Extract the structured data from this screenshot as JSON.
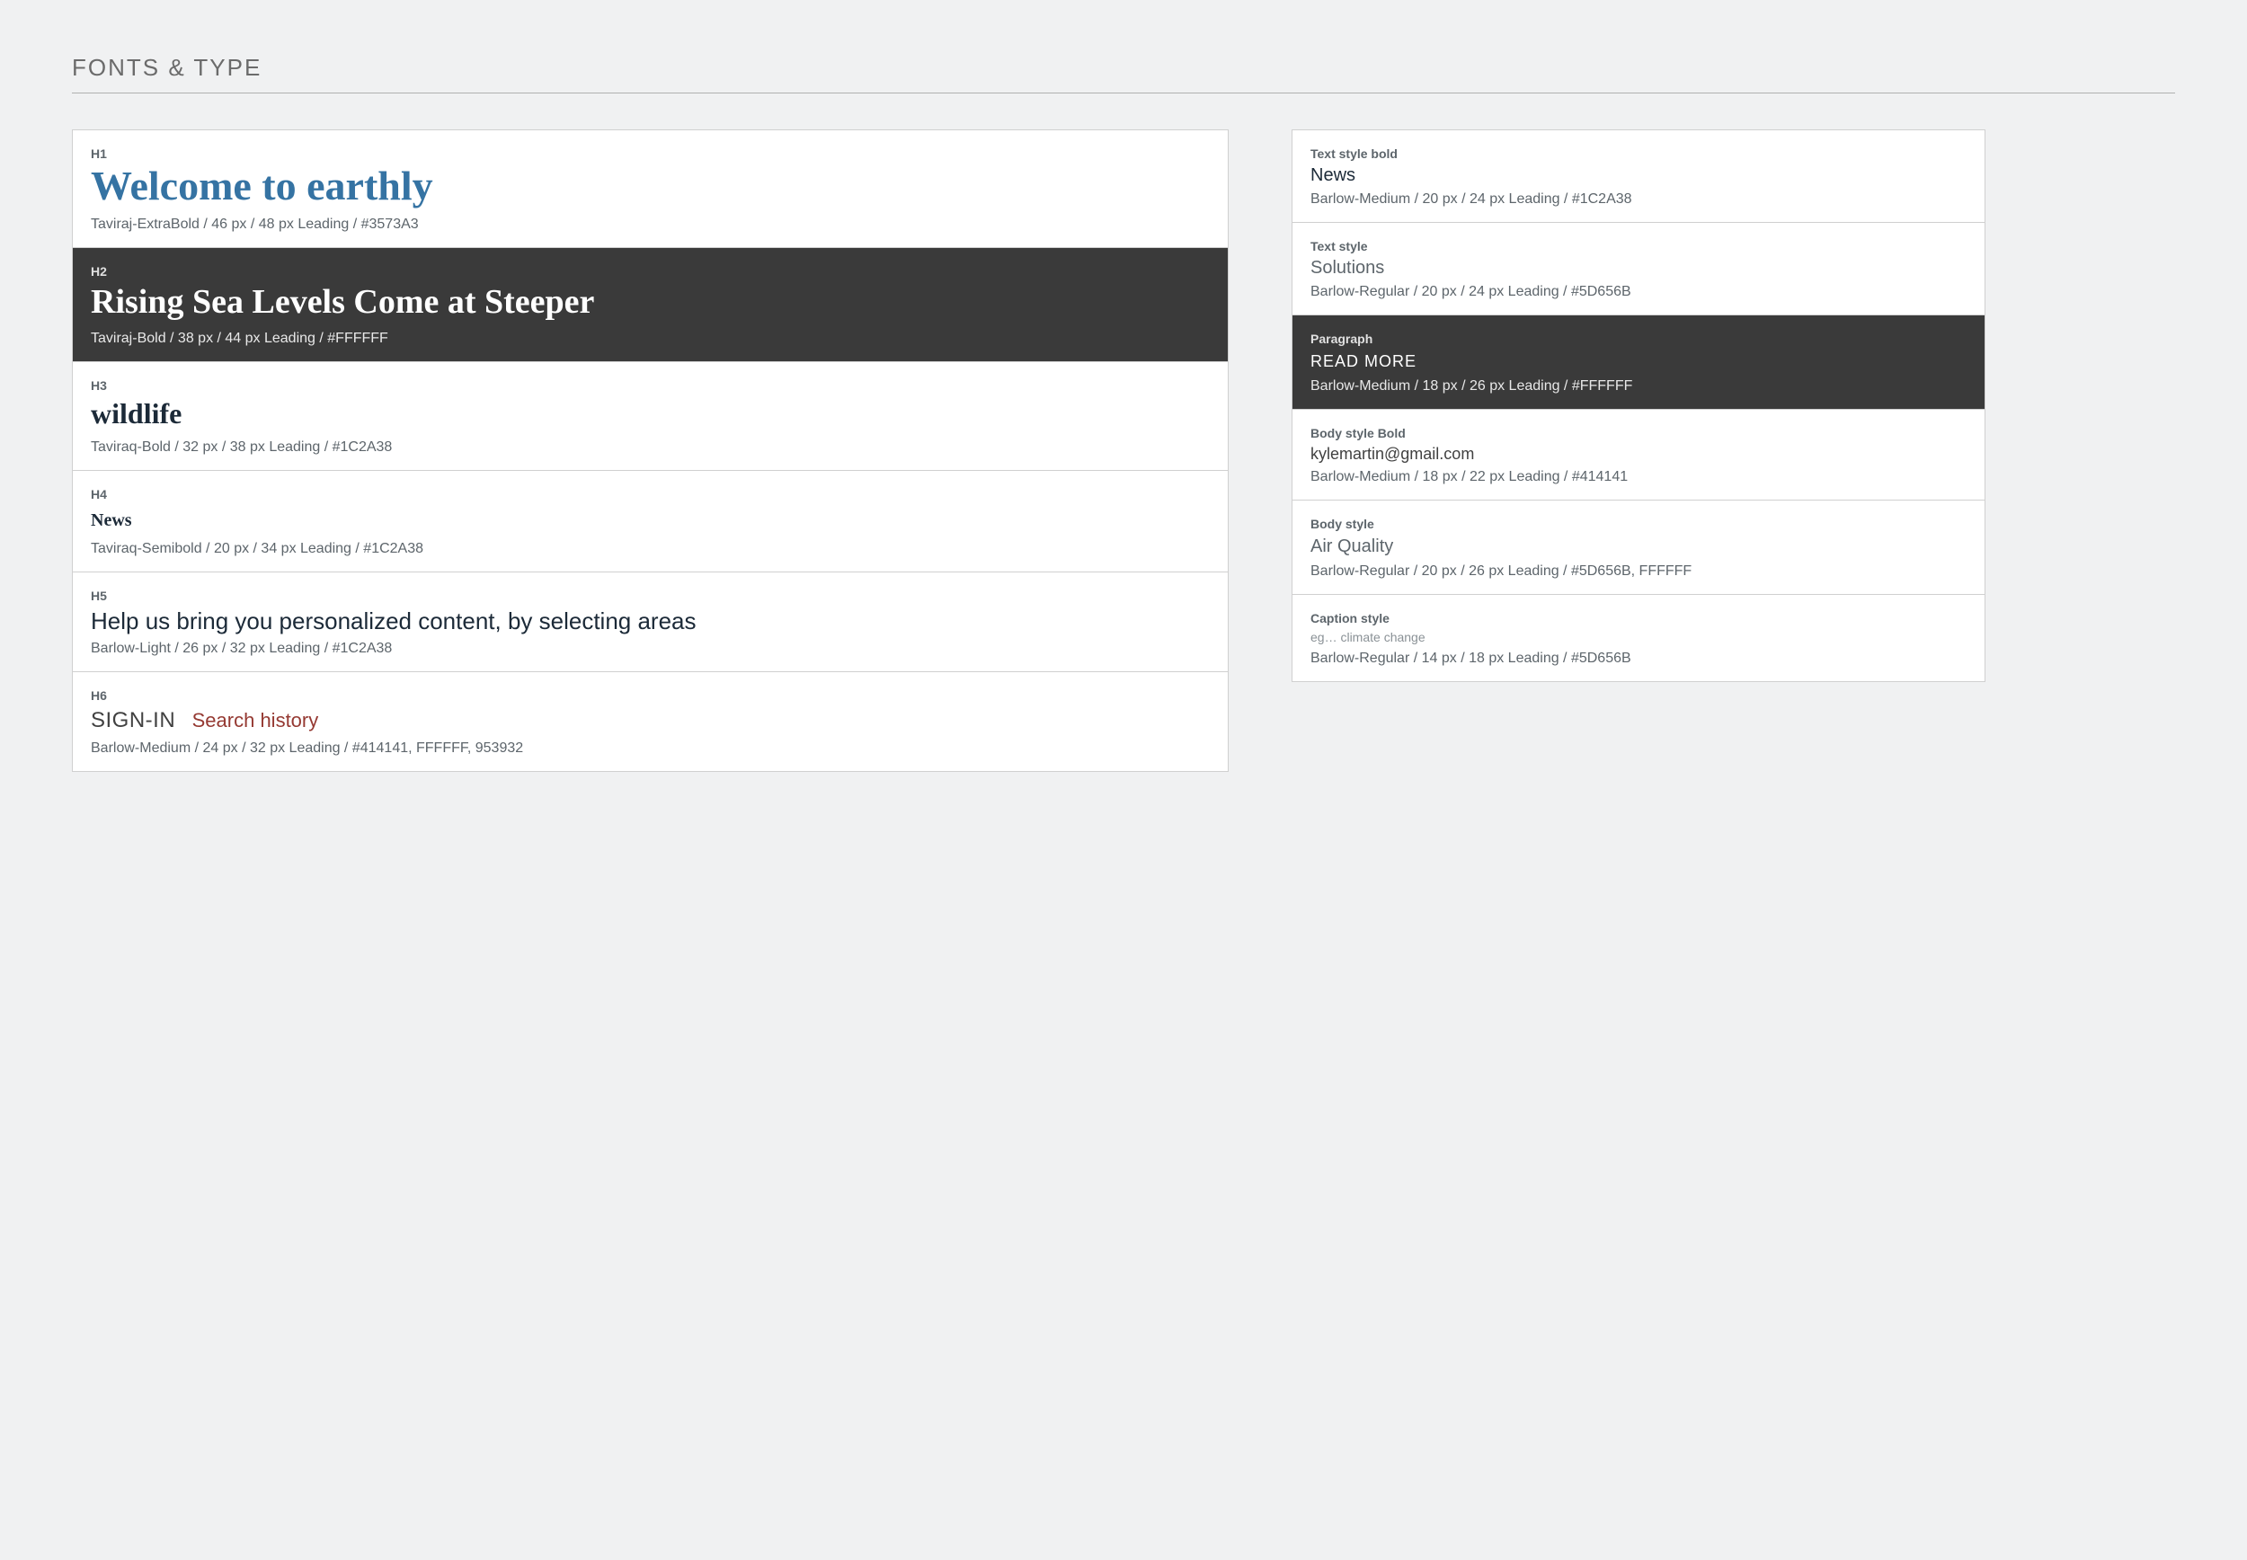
{
  "page_title": "FONTS & TYPE",
  "left": {
    "h1": {
      "label": "H1",
      "sample": "Welcome to earthly",
      "meta": "Taviraj-ExtraBold / 46 px / 48 px Leading / #3573A3"
    },
    "h2": {
      "label": "H2",
      "sample": "Rising Sea Levels Come at Steeper",
      "meta": "Taviraj-Bold / 38 px / 44 px Leading / #FFFFFF"
    },
    "h3": {
      "label": "H3",
      "sample": "wildlife",
      "meta": "Taviraq-Bold / 32 px / 38 px Leading / #1C2A38"
    },
    "h4": {
      "label": "H4",
      "sample": "News",
      "meta": "Taviraq-Semibold / 20 px / 34 px Leading / #1C2A38"
    },
    "h5": {
      "label": "H5",
      "sample": "Help us bring you personalized content, by selecting areas",
      "meta": "Barlow-Light / 26 px / 32 px Leading / #1C2A38"
    },
    "h6": {
      "label": "H6",
      "sample_a": "SIGN-IN",
      "sample_b": "Search history",
      "meta": "Barlow-Medium / 24 px / 32 px Leading / #414141, FFFFFF, 953932"
    }
  },
  "right": {
    "textbold": {
      "label": "Text style bold",
      "sample": "News",
      "meta": "Barlow-Medium / 20 px / 24 px Leading / #1C2A38"
    },
    "text": {
      "label": "Text style",
      "sample": "Solutions",
      "meta": "Barlow-Regular / 20 px / 24 px Leading / #5D656B"
    },
    "paragraph": {
      "label": "Paragraph",
      "sample": "READ MORE",
      "meta": "Barlow-Medium / 18 px / 26 px Leading / #FFFFFF"
    },
    "bodybold": {
      "label": "Body style Bold",
      "sample": "kylemartin@gmail.com",
      "meta": "Barlow-Medium / 18 px / 22 px Leading / #414141"
    },
    "body": {
      "label": "Body style",
      "sample": "Air Quality",
      "meta": "Barlow-Regular / 20 px / 26 px Leading / #5D656B, FFFFFF"
    },
    "caption": {
      "label": "Caption style",
      "sample": "eg… climate change",
      "meta": "Barlow-Regular / 14 px / 18 px Leading / #5D656B"
    }
  }
}
